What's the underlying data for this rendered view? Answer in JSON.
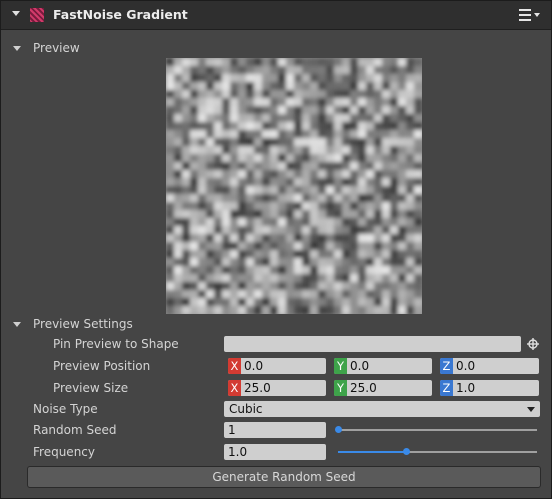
{
  "header": {
    "title": "FastNoise Gradient",
    "icon": "noise-component-icon",
    "menu_icon": "hamburger-menu-icon"
  },
  "preview_section": {
    "label": "Preview"
  },
  "preview_settings": {
    "label": "Preview Settings",
    "pin_label": "Pin Preview to Shape",
    "pin_value": "",
    "position_label": "Preview Position",
    "position": {
      "x": "0.0",
      "y": "0.0",
      "z": "0.0"
    },
    "size_label": "Preview Size",
    "size": {
      "x": "25.0",
      "y": "25.0",
      "z": "1.0"
    },
    "axis_labels": {
      "x": "X",
      "y": "Y",
      "z": "Z"
    }
  },
  "noise_type": {
    "label": "Noise Type",
    "value": "Cubic"
  },
  "random_seed": {
    "label": "Random Seed",
    "value": "1",
    "slider_fraction": 0.0
  },
  "frequency": {
    "label": "Frequency",
    "value": "1.0",
    "slider_fraction": 0.34
  },
  "generate_button": {
    "label": "Generate Random Seed"
  },
  "colors": {
    "accent": "#3a8ae8",
    "axis_x": "#d33b32",
    "axis_y": "#3ea34a",
    "axis_z": "#3a78d1"
  }
}
